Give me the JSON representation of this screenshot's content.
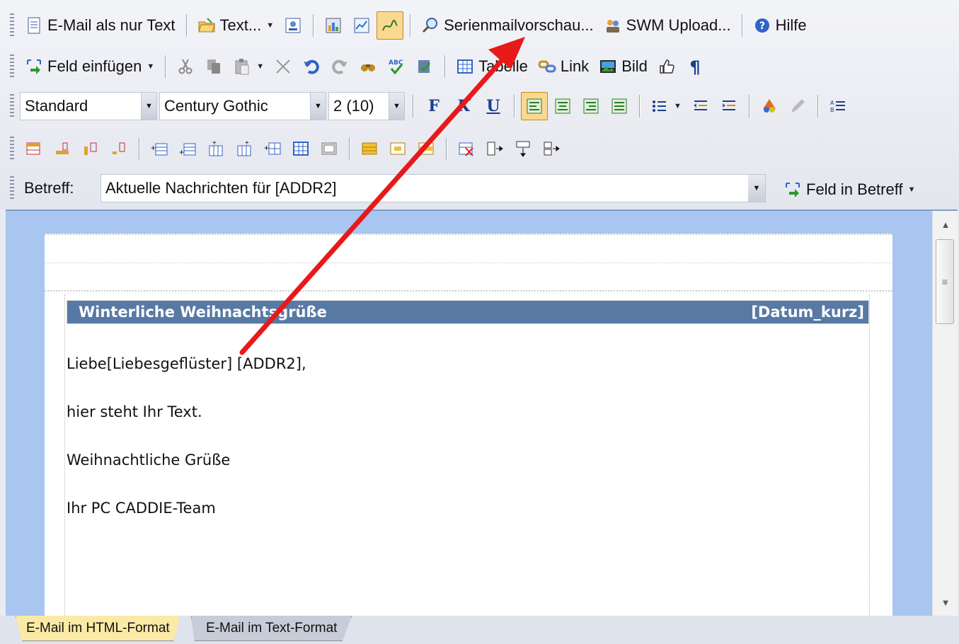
{
  "toolbar_row1": {
    "email_text_only": "E-Mail als nur Text",
    "text_menu": "Text...",
    "serienmail_preview": "Serienmailvorschau...",
    "swm_upload": "SWM Upload...",
    "help": "Hilfe"
  },
  "toolbar_row2": {
    "insert_field": "Feld einfügen",
    "table": "Tabelle",
    "link": "Link",
    "image": "Bild"
  },
  "toolbar_row3": {
    "style_value": "Standard",
    "font_value": "Century Gothic",
    "size_value": "2 (10)",
    "bold": "F",
    "italic": "K",
    "underline": "U"
  },
  "subject": {
    "label": "Betreff:",
    "value": "Aktuelle Nachrichten für [ADDR2]",
    "insert_field_label": "Feld in Betreff"
  },
  "document": {
    "header_title": "Winterliche Weihnachtsgrüße",
    "header_date": "[Datum_kurz]",
    "greeting": "Liebe[Liebesgeflüster] [ADDR2],",
    "line1": "hier steht Ihr Text.",
    "line2": "Weihnachtliche Grüße",
    "line3": "Ihr PC CADDIE-Team"
  },
  "tabs": {
    "html": "E-Mail im HTML-Format",
    "text": "E-Mail im Text-Format"
  },
  "colors": {
    "header_bar": "#5779a4",
    "editor_bg": "#a8c6f0",
    "annotation_arrow": "#e81919",
    "active_tab": "#fbe9a6"
  }
}
